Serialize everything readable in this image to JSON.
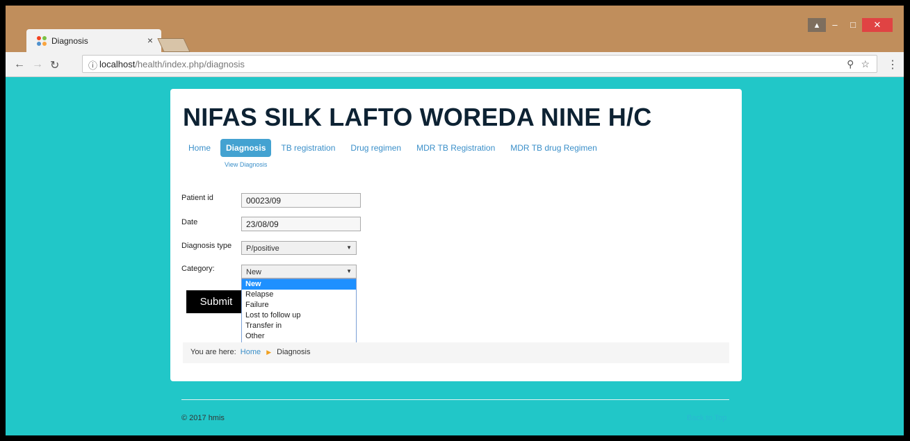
{
  "browser": {
    "tab_title": "Diagnosis",
    "tab_close": "×",
    "url_host": "localhost",
    "url_path": "/health/index.php/diagnosis"
  },
  "site": {
    "title": "NIFAS SILK LAFTO WOREDA NINE H/C",
    "nav": [
      "Home",
      "Diagnosis",
      "TB registration",
      "Drug regimen",
      "MDR TB Registration",
      "MDR TB drug Regimen"
    ],
    "active_nav": "Diagnosis",
    "subnav": "View Diagnosis"
  },
  "form": {
    "patient_id_label": "Patient id",
    "patient_id_value": "00023/09",
    "date_label": "Date",
    "date_value": "23/08/09",
    "diagnosis_type_label": "Diagnosis type",
    "diagnosis_type_value": "P/positive",
    "category_label": "Category:",
    "category_value": "New",
    "category_options": [
      "New",
      "Relapse",
      "Failure",
      "Lost to follow up",
      "Transfer in",
      "Other"
    ],
    "submit_label": "Submit"
  },
  "breadcrumb": {
    "prefix": "You are here:",
    "home": "Home",
    "current": "Diagnosis"
  },
  "footer": {
    "copyright": "© 2017 hmis",
    "back_to_top": "Back to Top"
  },
  "colors": {
    "page_bg": "#21c7c8",
    "accent": "#43a2d1",
    "link": "#3a8fc9"
  }
}
